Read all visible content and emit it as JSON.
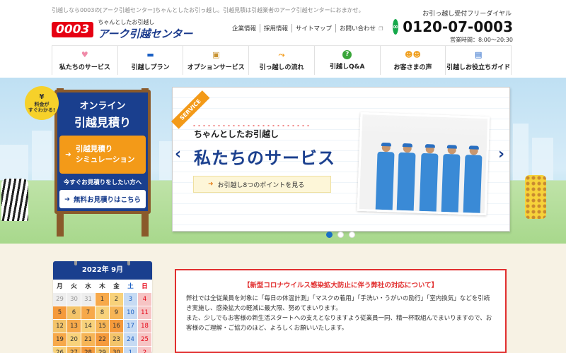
{
  "header": {
    "tagline": "引越しなら0003の[アーク引越センター]ちゃんとしたお引っ越し。引越見積は引越業者のアーク引越センターにおまかせ。",
    "logo_num": "0003",
    "logo_sub": "ちゃんとしたお引越し",
    "logo_main": "アーク引越センター",
    "util_links": [
      "企業情報",
      "採用情報",
      "サイトマップ",
      "お問い合わせ"
    ],
    "phone_label": "お引っ越し受付フリーダイヤル",
    "phone_number": "0120-07-0003",
    "hours": "営業時間：8:00〜20:30"
  },
  "nav": [
    {
      "label": "私たちのサービス",
      "icon": "heart-icon",
      "glyph": "♥",
      "color": "#f08aa8"
    },
    {
      "label": "引越しプラン",
      "icon": "truck-icon",
      "glyph": "▬",
      "color": "#1a5fc4"
    },
    {
      "label": "オプションサービス",
      "icon": "box-icon",
      "glyph": "▣",
      "color": "#c8922f"
    },
    {
      "label": "引っ越しの流れ",
      "icon": "flow-arrow-icon",
      "glyph": "⤳",
      "color": "#f39a18"
    },
    {
      "label": "引越しQ&A",
      "icon": "question-icon",
      "glyph": "?",
      "color": "#3aa63a"
    },
    {
      "label": "お客さまの声",
      "icon": "people-icon",
      "glyph": "☻",
      "color": "#f0a020"
    },
    {
      "label": "引越しお役立ちガイド",
      "icon": "book-icon",
      "glyph": "▤",
      "color": "#1a5fc4"
    }
  ],
  "board": {
    "badge_yen": "¥",
    "badge_text": "料金が\nすぐわかる!",
    "title1": "オンライン",
    "title2": "引越見積り",
    "sim_button": "引越見積り\nシミュレーション",
    "prompt": "今すぐお見積りをしたい方へ",
    "free_button": "無料お見積りはこちら"
  },
  "slide": {
    "tag": "SERVICE",
    "subtitle": "ちゃんとしたお引越し",
    "title": "私たちのサービス",
    "link": "お引越し8つのポイントを見る",
    "slide_count": 3,
    "active_slide": 1
  },
  "calendar": {
    "title": "2022年 9月",
    "dow": [
      "月",
      "火",
      "水",
      "木",
      "金",
      "土",
      "日"
    ],
    "rows": [
      [
        "29",
        "30",
        "31",
        "1",
        "2",
        "3",
        "4"
      ],
      [
        "5",
        "6",
        "7",
        "8",
        "9",
        "10",
        "11"
      ],
      [
        "12",
        "13",
        "14",
        "15",
        "16",
        "17",
        "18"
      ],
      [
        "19",
        "20",
        "21",
        "22",
        "23",
        "24",
        "25"
      ],
      [
        "26",
        "27",
        "28",
        "29",
        "30",
        "1",
        "2"
      ]
    ]
  },
  "notice": {
    "title": "【新型コロナウイルス感染拡大防止に伴う弊社の対応について】",
    "p1": "弊社では全従業員を対象に「毎日の体温計測」「マスクの着用」「手洗い・うがいの励行」「室内換気」などを引続き実施し、感染拡大の軽減に最大限、努めてまいります。",
    "p2": "また、少しでもお客様の新生活スタートへの支えとなりますよう従業員一同、精一杯取組んでまいりますので、お客様のご理解・ご協力のほど、よろしくお願いいたします。"
  },
  "colors": {
    "brand_red": "#e60012",
    "brand_blue": "#1a3f8e",
    "accent_orange": "#f39a18"
  }
}
